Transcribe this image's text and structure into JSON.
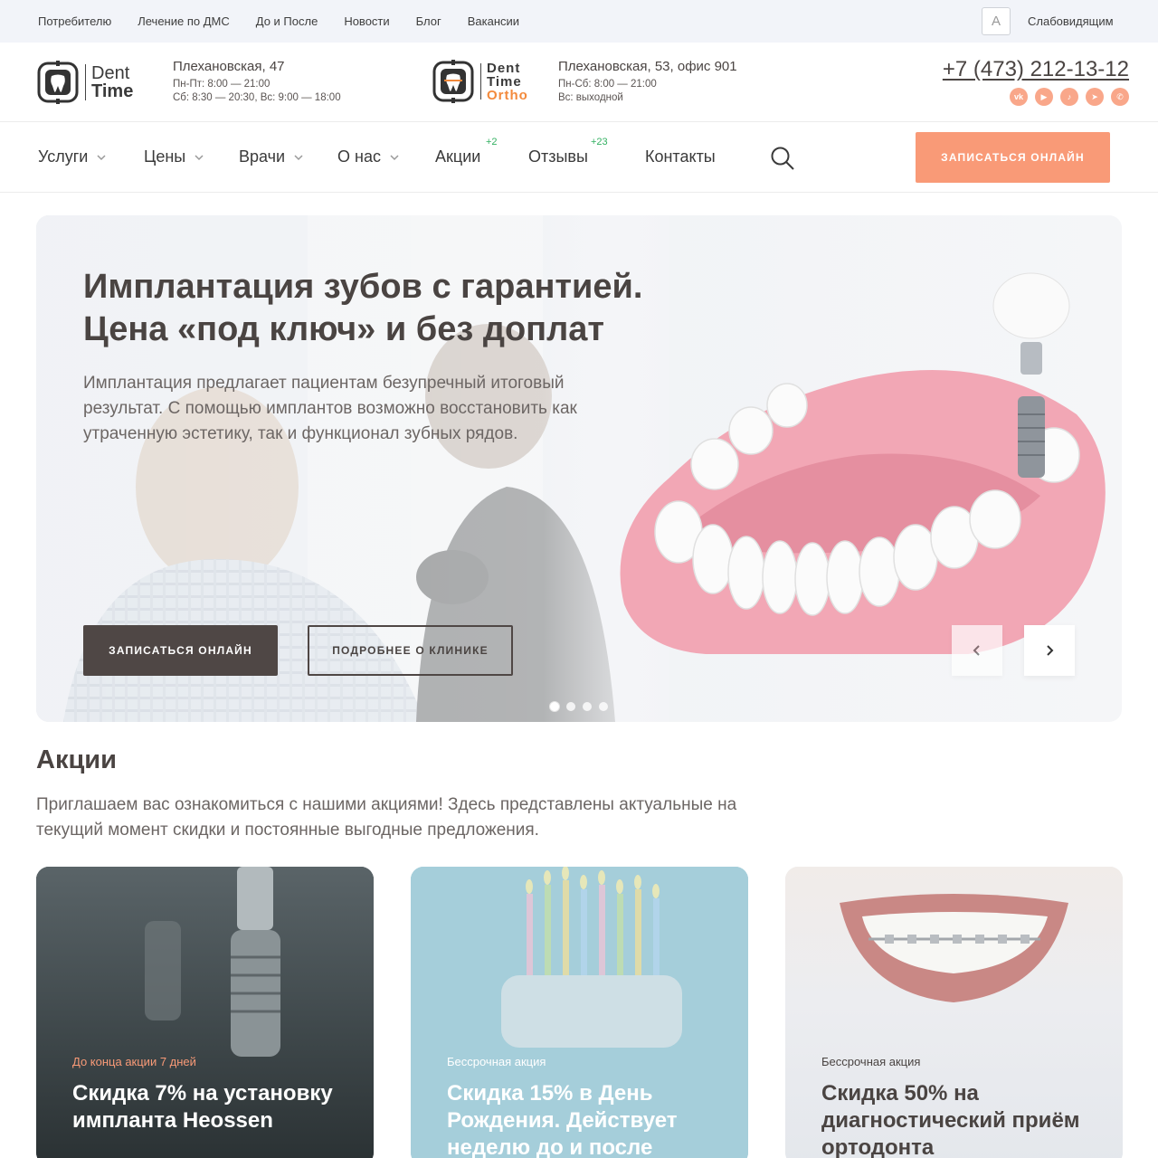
{
  "topbar": {
    "links": [
      "Потребителю",
      "Лечение по ДМС",
      "До и После",
      "Новости",
      "Блог",
      "Вакансии"
    ],
    "font_toggle": "A",
    "vision_label": "Слабовидящим"
  },
  "header": {
    "logo1": {
      "line1": "Dent",
      "line2": "Time"
    },
    "address1": {
      "street": "Плехановская, 47",
      "hours1": "Пн-Пт: 8:00 — 21:00",
      "hours2": "Сб: 8:30 — 20:30, Вс: 9:00 — 18:00"
    },
    "logo2": {
      "line1": "Dent",
      "line2": "Time",
      "line3": "Ortho"
    },
    "address2": {
      "street": "Плехановская, 53, офис 901",
      "hours1": "Пн-Сб: 8:00 — 21:00",
      "hours2": "Вс: выходной"
    },
    "phone": "+7 (473) 212-13-12",
    "social_icons": [
      "vk-icon",
      "youtube-icon",
      "tiktok-icon",
      "telegram-icon",
      "whatsapp-icon"
    ],
    "social_color": "#f9a78a"
  },
  "nav": {
    "items": [
      {
        "label": "Услуги"
      },
      {
        "label": "Цены"
      },
      {
        "label": "Врачи"
      },
      {
        "label": "О нас"
      },
      {
        "label": "Акции",
        "badge": "+2"
      },
      {
        "label": "Отзывы",
        "badge": "+23"
      },
      {
        "label": "Контакты"
      }
    ],
    "cta": "ЗАПИСАТЬСЯ ОНЛАЙН",
    "accent": "#f99a77",
    "badge_color": "#33b061"
  },
  "hero": {
    "title": "Имплантация зубов с гарантией. Цена «под ключ» и без доплат",
    "text": "Имплантация предлагает пациентам безупречный итоговый результат. С помощью имплантов возможно восстановить как утраченную эстетику, так и функционал зубных рядов.",
    "btn_primary": "ЗАПИСАТЬСЯ ОНЛАЙН",
    "btn_secondary": "ПОДРОБНЕЕ О КЛИНИКЕ",
    "slides_count": 4,
    "active_slide": 1
  },
  "promo": {
    "title": "Акции",
    "text": "Приглашаем вас ознакомиться с нашими акциями! Здесь представлены актуальные на текущий момент скидки и постоянные выгодные предложения.",
    "cards": [
      {
        "tag": "До конца акции 7 дней",
        "title": "Скидка 7% на установку импланта Heossen"
      },
      {
        "tag": "Бессрочная акция",
        "title": "Скидка 15% в День Рождения. Действует неделю до и после"
      },
      {
        "tag": "Бессрочная акция",
        "title": "Скидка 50% на диагностический приём ортодонта"
      }
    ]
  }
}
